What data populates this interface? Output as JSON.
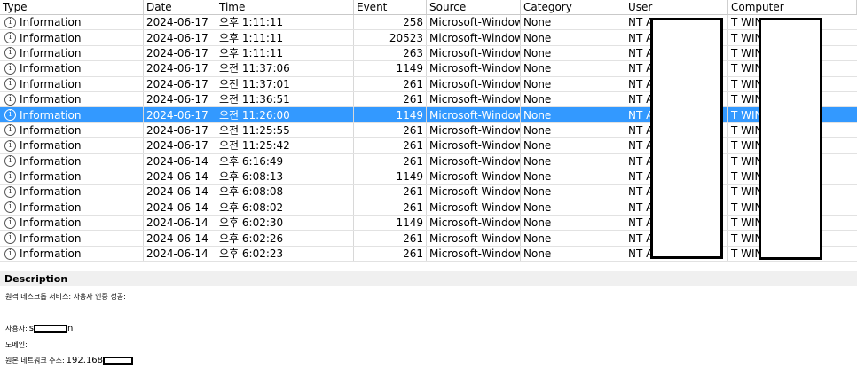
{
  "columns": {
    "type": "Type",
    "date": "Date",
    "time": "Time",
    "event": "Event",
    "source": "Source",
    "category": "Category",
    "user": "User",
    "computer": "Computer"
  },
  "rows": [
    {
      "type": "Information",
      "date": "2024-06-17",
      "time": "오후 1:11:11",
      "event": "258",
      "source": "Microsoft-Windows-",
      "category": "None",
      "user": "NT A",
      "computer": "T WIN-",
      "selected": false
    },
    {
      "type": "Information",
      "date": "2024-06-17",
      "time": "오후 1:11:11",
      "event": "20523",
      "source": "Microsoft-Windows-",
      "category": "None",
      "user": "NT A",
      "computer": "T WIN-",
      "selected": false
    },
    {
      "type": "Information",
      "date": "2024-06-17",
      "time": "오후 1:11:11",
      "event": "263",
      "source": "Microsoft-Windows-",
      "category": "None",
      "user": "NT A",
      "computer": "T WIN-",
      "selected": false
    },
    {
      "type": "Information",
      "date": "2024-06-17",
      "time": "오전 11:37:06",
      "event": "1149",
      "source": "Microsoft-Windows-",
      "category": "None",
      "user": "NT A",
      "computer": "T WIN-",
      "selected": false
    },
    {
      "type": "Information",
      "date": "2024-06-17",
      "time": "오전 11:37:01",
      "event": "261",
      "source": "Microsoft-Windows-",
      "category": "None",
      "user": "NT A",
      "computer": "T WIN-",
      "selected": false
    },
    {
      "type": "Information",
      "date": "2024-06-17",
      "time": "오전 11:36:51",
      "event": "261",
      "source": "Microsoft-Windows-",
      "category": "None",
      "user": "NT A",
      "computer": "T WIN-",
      "selected": false
    },
    {
      "type": "Information",
      "date": "2024-06-17",
      "time": "오전 11:26:00",
      "event": "1149",
      "source": "Microsoft-Windows-",
      "category": "None",
      "user": "NT A",
      "computer": "T WIN-",
      "selected": true
    },
    {
      "type": "Information",
      "date": "2024-06-17",
      "time": "오전 11:25:55",
      "event": "261",
      "source": "Microsoft-Windows-",
      "category": "None",
      "user": "NT A",
      "computer": "T WIN-",
      "selected": false
    },
    {
      "type": "Information",
      "date": "2024-06-17",
      "time": "오전 11:25:42",
      "event": "261",
      "source": "Microsoft-Windows-",
      "category": "None",
      "user": "NT A",
      "computer": "T WIN-",
      "selected": false
    },
    {
      "type": "Information",
      "date": "2024-06-14",
      "time": "오후 6:16:49",
      "event": "261",
      "source": "Microsoft-Windows-",
      "category": "None",
      "user": "NT A",
      "computer": "T WIN-",
      "selected": false
    },
    {
      "type": "Information",
      "date": "2024-06-14",
      "time": "오후 6:08:13",
      "event": "1149",
      "source": "Microsoft-Windows-",
      "category": "None",
      "user": "NT A",
      "computer": "T WIN-",
      "selected": false
    },
    {
      "type": "Information",
      "date": "2024-06-14",
      "time": "오후 6:08:08",
      "event": "261",
      "source": "Microsoft-Windows-",
      "category": "None",
      "user": "NT A",
      "computer": "T WIN-",
      "selected": false
    },
    {
      "type": "Information",
      "date": "2024-06-14",
      "time": "오후 6:08:02",
      "event": "261",
      "source": "Microsoft-Windows-",
      "category": "None",
      "user": "NT A",
      "computer": "T WIN-",
      "selected": false
    },
    {
      "type": "Information",
      "date": "2024-06-14",
      "time": "오후 6:02:30",
      "event": "1149",
      "source": "Microsoft-Windows-",
      "category": "None",
      "user": "NT A",
      "computer": "T WIN-",
      "selected": false
    },
    {
      "type": "Information",
      "date": "2024-06-14",
      "time": "오후 6:02:26",
      "event": "261",
      "source": "Microsoft-Windows-",
      "category": "None",
      "user": "NT A",
      "computer": "T WIN-",
      "selected": false
    },
    {
      "type": "Information",
      "date": "2024-06-14",
      "time": "오후 6:02:23",
      "event": "261",
      "source": "Microsoft-Windows-",
      "category": "None",
      "user": "NT A",
      "computer": "T WIN-",
      "selected": false
    }
  ],
  "row_icon": "info-icon",
  "selection_color": "#3399ff",
  "description": {
    "title": "Description",
    "line1": "원격 데스크톱 서비스: 사용자 인증 성공:",
    "user_label": "사용자:",
    "user_value_prefix": "s",
    "user_value_suffix": "n",
    "domain_label": "도메인:",
    "address_label": "원본 네트워크 주소:",
    "address_value": "192.168"
  }
}
